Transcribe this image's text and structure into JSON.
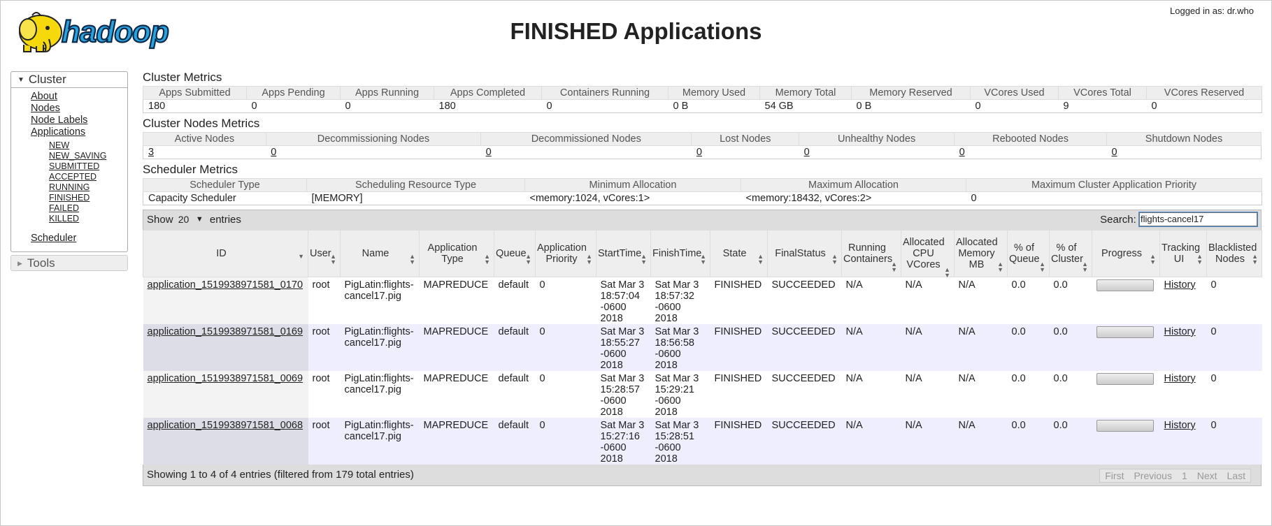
{
  "header": {
    "logo_text": "hadoop",
    "title": "FINISHED Applications",
    "logged_in": "Logged in as: dr.who"
  },
  "sidebar": {
    "cluster_label": "Cluster",
    "links": [
      "About",
      "Nodes",
      "Node Labels",
      "Applications"
    ],
    "app_states": [
      "NEW",
      "NEW_SAVING",
      "SUBMITTED",
      "ACCEPTED",
      "RUNNING",
      "FINISHED",
      "FAILED",
      "KILLED"
    ],
    "scheduler": "Scheduler",
    "tools_label": "Tools"
  },
  "cluster_metrics": {
    "title": "Cluster Metrics",
    "headers": [
      "Apps Submitted",
      "Apps Pending",
      "Apps Running",
      "Apps Completed",
      "Containers Running",
      "Memory Used",
      "Memory Total",
      "Memory Reserved",
      "VCores Used",
      "VCores Total",
      "VCores Reserved"
    ],
    "values": [
      "180",
      "0",
      "0",
      "180",
      "0",
      "0 B",
      "54 GB",
      "0 B",
      "0",
      "9",
      "0"
    ]
  },
  "node_metrics": {
    "title": "Cluster Nodes Metrics",
    "headers": [
      "Active Nodes",
      "Decommissioning Nodes",
      "Decommissioned Nodes",
      "Lost Nodes",
      "Unhealthy Nodes",
      "Rebooted Nodes",
      "Shutdown Nodes"
    ],
    "values": [
      "3",
      "0",
      "0",
      "0",
      "0",
      "0",
      "0"
    ]
  },
  "scheduler_metrics": {
    "title": "Scheduler Metrics",
    "headers": [
      "Scheduler Type",
      "Scheduling Resource Type",
      "Minimum Allocation",
      "Maximum Allocation",
      "Maximum Cluster Application Priority"
    ],
    "values": [
      "Capacity Scheduler",
      "[MEMORY]",
      "<memory:1024, vCores:1>",
      "<memory:18432, vCores:2>",
      "0"
    ]
  },
  "table_controls": {
    "show_label": "Show",
    "page_size": "20",
    "entries_label": "entries",
    "search_label": "Search:",
    "search_value": "flights-cancel17"
  },
  "apps_table": {
    "headers": [
      "ID",
      "User",
      "Name",
      "Application Type",
      "Queue",
      "Application Priority",
      "StartTime",
      "FinishTime",
      "State",
      "FinalStatus",
      "Running Containers",
      "Allocated CPU VCores",
      "Allocated Memory MB",
      "% of Queue",
      "% of Cluster",
      "Progress",
      "Tracking UI",
      "Blacklisted Nodes"
    ],
    "rows": [
      {
        "id": "application_1519938971581_0170",
        "user": "root",
        "name": "PigLatin:flights-cancel17.pig",
        "type": "MAPREDUCE",
        "queue": "default",
        "priority": "0",
        "start": "Sat Mar 3 18:57:04 -0600 2018",
        "finish": "Sat Mar 3 18:57:32 -0600 2018",
        "state": "FINISHED",
        "final_status": "SUCCEEDED",
        "running_containers": "N/A",
        "vcores": "N/A",
        "memory": "N/A",
        "pct_queue": "0.0",
        "pct_cluster": "0.0",
        "progress": 1.0,
        "tracking": "History",
        "blacklisted": "0"
      },
      {
        "id": "application_1519938971581_0169",
        "user": "root",
        "name": "PigLatin:flights-cancel17.pig",
        "type": "MAPREDUCE",
        "queue": "default",
        "priority": "0",
        "start": "Sat Mar 3 18:55:27 -0600 2018",
        "finish": "Sat Mar 3 18:56:58 -0600 2018",
        "state": "FINISHED",
        "final_status": "SUCCEEDED",
        "running_containers": "N/A",
        "vcores": "N/A",
        "memory": "N/A",
        "pct_queue": "0.0",
        "pct_cluster": "0.0",
        "progress": 1.0,
        "tracking": "History",
        "blacklisted": "0"
      },
      {
        "id": "application_1519938971581_0069",
        "user": "root",
        "name": "PigLatin:flights-cancel17.pig",
        "type": "MAPREDUCE",
        "queue": "default",
        "priority": "0",
        "start": "Sat Mar 3 15:28:57 -0600 2018",
        "finish": "Sat Mar 3 15:29:21 -0600 2018",
        "state": "FINISHED",
        "final_status": "SUCCEEDED",
        "running_containers": "N/A",
        "vcores": "N/A",
        "memory": "N/A",
        "pct_queue": "0.0",
        "pct_cluster": "0.0",
        "progress": 1.0,
        "tracking": "History",
        "blacklisted": "0"
      },
      {
        "id": "application_1519938971581_0068",
        "user": "root",
        "name": "PigLatin:flights-cancel17.pig",
        "type": "MAPREDUCE",
        "queue": "default",
        "priority": "0",
        "start": "Sat Mar 3 15:27:16 -0600 2018",
        "finish": "Sat Mar 3 15:28:51 -0600 2018",
        "state": "FINISHED",
        "final_status": "SUCCEEDED",
        "running_containers": "N/A",
        "vcores": "N/A",
        "memory": "N/A",
        "pct_queue": "0.0",
        "pct_cluster": "0.0",
        "progress": 1.0,
        "tracking": "History",
        "blacklisted": "0"
      }
    ]
  },
  "footer": {
    "info": "Showing 1 to 4 of 4 entries (filtered from 179 total entries)",
    "pager": [
      "First",
      "Previous",
      "1",
      "Next",
      "Last"
    ]
  }
}
